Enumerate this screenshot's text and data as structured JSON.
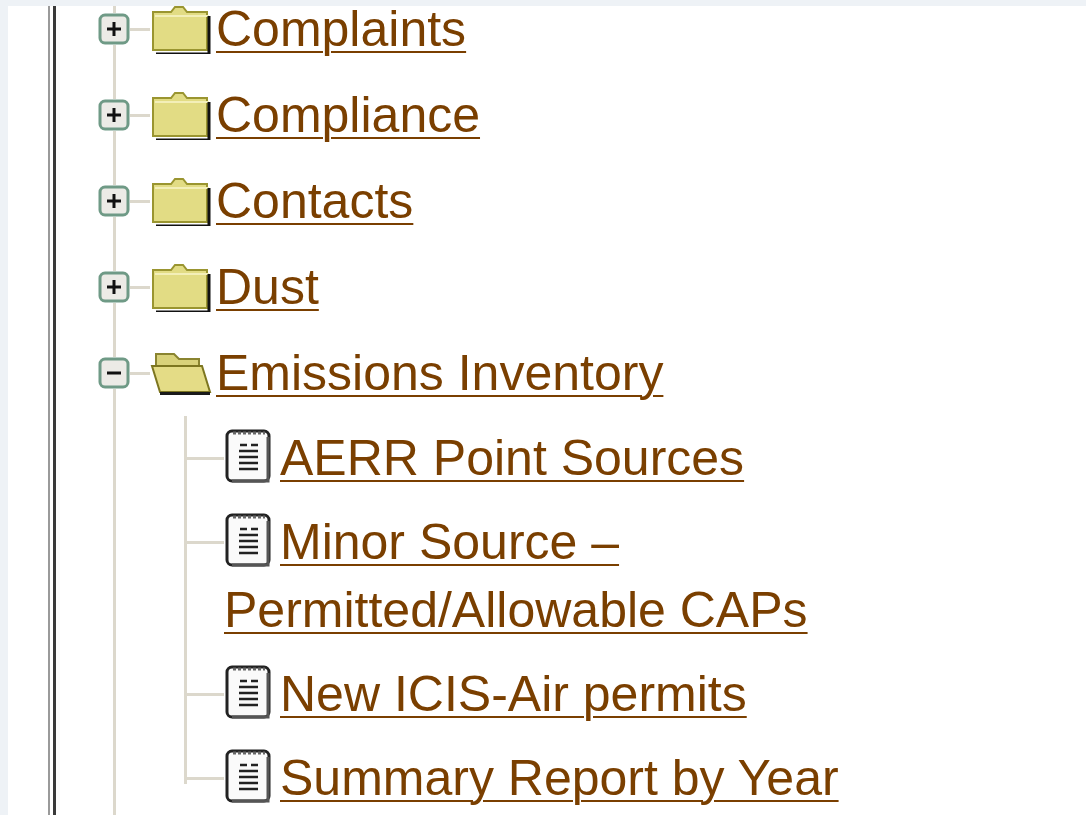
{
  "tree": {
    "items": [
      {
        "kind": "folder",
        "label": "Complaints",
        "expanded": false
      },
      {
        "kind": "folder",
        "label": "Compliance",
        "expanded": false
      },
      {
        "kind": "folder",
        "label": "Contacts",
        "expanded": false
      },
      {
        "kind": "folder",
        "label": "Dust",
        "expanded": false
      },
      {
        "kind": "folder",
        "label": "Emissions Inventory",
        "expanded": true,
        "children": [
          {
            "kind": "document",
            "label": "AERR Point Sources"
          },
          {
            "kind": "document",
            "label": "Minor Source – Permitted/Allowable CAPs"
          },
          {
            "kind": "document",
            "label": "New ICIS-Air permits"
          },
          {
            "kind": "document",
            "label": "Summary Report by Year"
          }
        ]
      }
    ]
  }
}
